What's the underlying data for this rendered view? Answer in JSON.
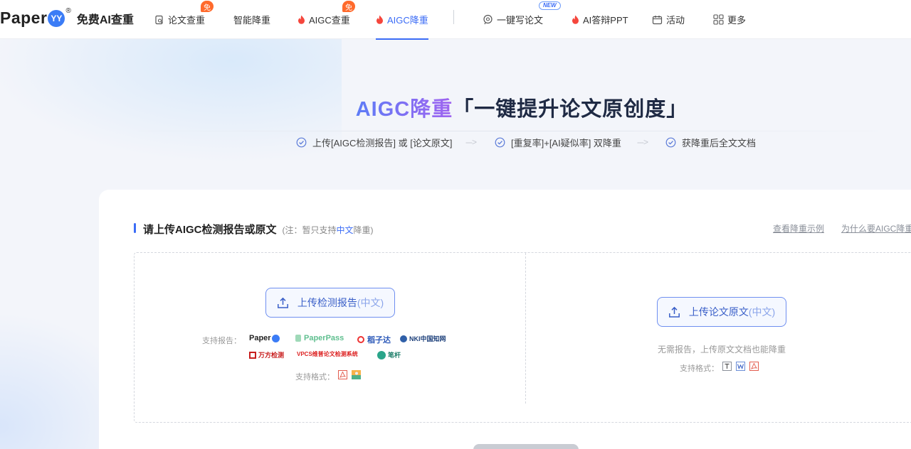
{
  "logo": {
    "brand": "Paper",
    "mark": "YY",
    "reg": "®",
    "subtitle": "免费AI查重"
  },
  "nav": {
    "items": [
      {
        "label": "论文查重",
        "badge": "免"
      },
      {
        "label": "智能降重"
      },
      {
        "label": "AIGC查重",
        "badge": "免"
      },
      {
        "label": "AIGC降重",
        "active": true
      },
      {
        "label": "一键写论文",
        "badge": "NEW"
      },
      {
        "label": "AI答辩PPT"
      },
      {
        "label": "活动"
      },
      {
        "label": "更多"
      }
    ]
  },
  "hero": {
    "title_accent": "AIGC降重",
    "title_rest": "「一键提升论文原创度」",
    "steps": [
      "上传[AIGC检测报告] 或 [论文原文]",
      "[重复率]+[AI疑似率] 双降重",
      "获降重后全文文档"
    ],
    "arrow": "--->"
  },
  "card": {
    "title": "请上传AIGC检测报告或原文",
    "note_prefix": "(注：暂只支持",
    "note_highlight": "中文",
    "note_suffix": "降重)",
    "link_example": "查看降重示例",
    "link_why": "为什么要AIGC降重",
    "left": {
      "button_label": "上传检测报告",
      "button_paren": "(中文)",
      "supported_reports_label": "支持报告：",
      "brands": [
        "Paper",
        "PaperPass",
        "稻子达",
        "NKI中国知网",
        "万方检测",
        "VPCS维普论文检测系统",
        "笔杆"
      ],
      "formats_label": "支持格式："
    },
    "right": {
      "button_label": "上传论文原文",
      "button_paren": "(中文)",
      "hint": "无需报告，上传原文文档也能降重",
      "formats_label": "支持格式："
    }
  },
  "colors": {
    "accent": "#3b6cf6",
    "badge": "#ff6a2c",
    "fire": "#f5463c"
  }
}
